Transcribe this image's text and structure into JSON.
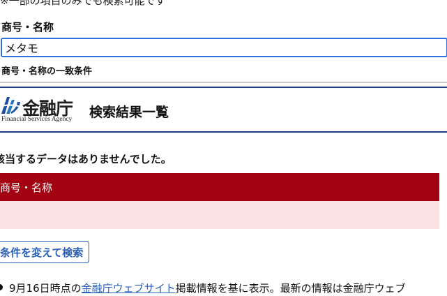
{
  "search_form": {
    "note": "※一部の項目のみでも検索可能です",
    "name_label": "商号・名称",
    "name_value": "メタモ",
    "match_condition_label": "商号・名称の一致条件"
  },
  "header": {
    "logo_kanji": "金融庁",
    "logo_english": "Financial Services Agency",
    "results_title": "検索結果一覧"
  },
  "results": {
    "message": "該当するデータはありませんでした。",
    "columns": [
      "商号・名称"
    ],
    "rows": []
  },
  "actions": {
    "retry_label": "条件を変えて検索"
  },
  "footnote": {
    "prefix": "9月16日時点の",
    "link_text": "金融庁ウェブサイト",
    "suffix": "掲載情報を基に表示。最新の情報は金融庁ウェブ"
  },
  "colors": {
    "accent_blue": "#2f6fe0",
    "header_rule": "#1b3f8b",
    "table_header_bg": "#a10312",
    "table_row_bg": "#fde2e4",
    "link": "#2b5fb5"
  },
  "icons": {
    "logo_mark": "fsa-logo-mark-icon",
    "bullet": "bullet-icon"
  }
}
